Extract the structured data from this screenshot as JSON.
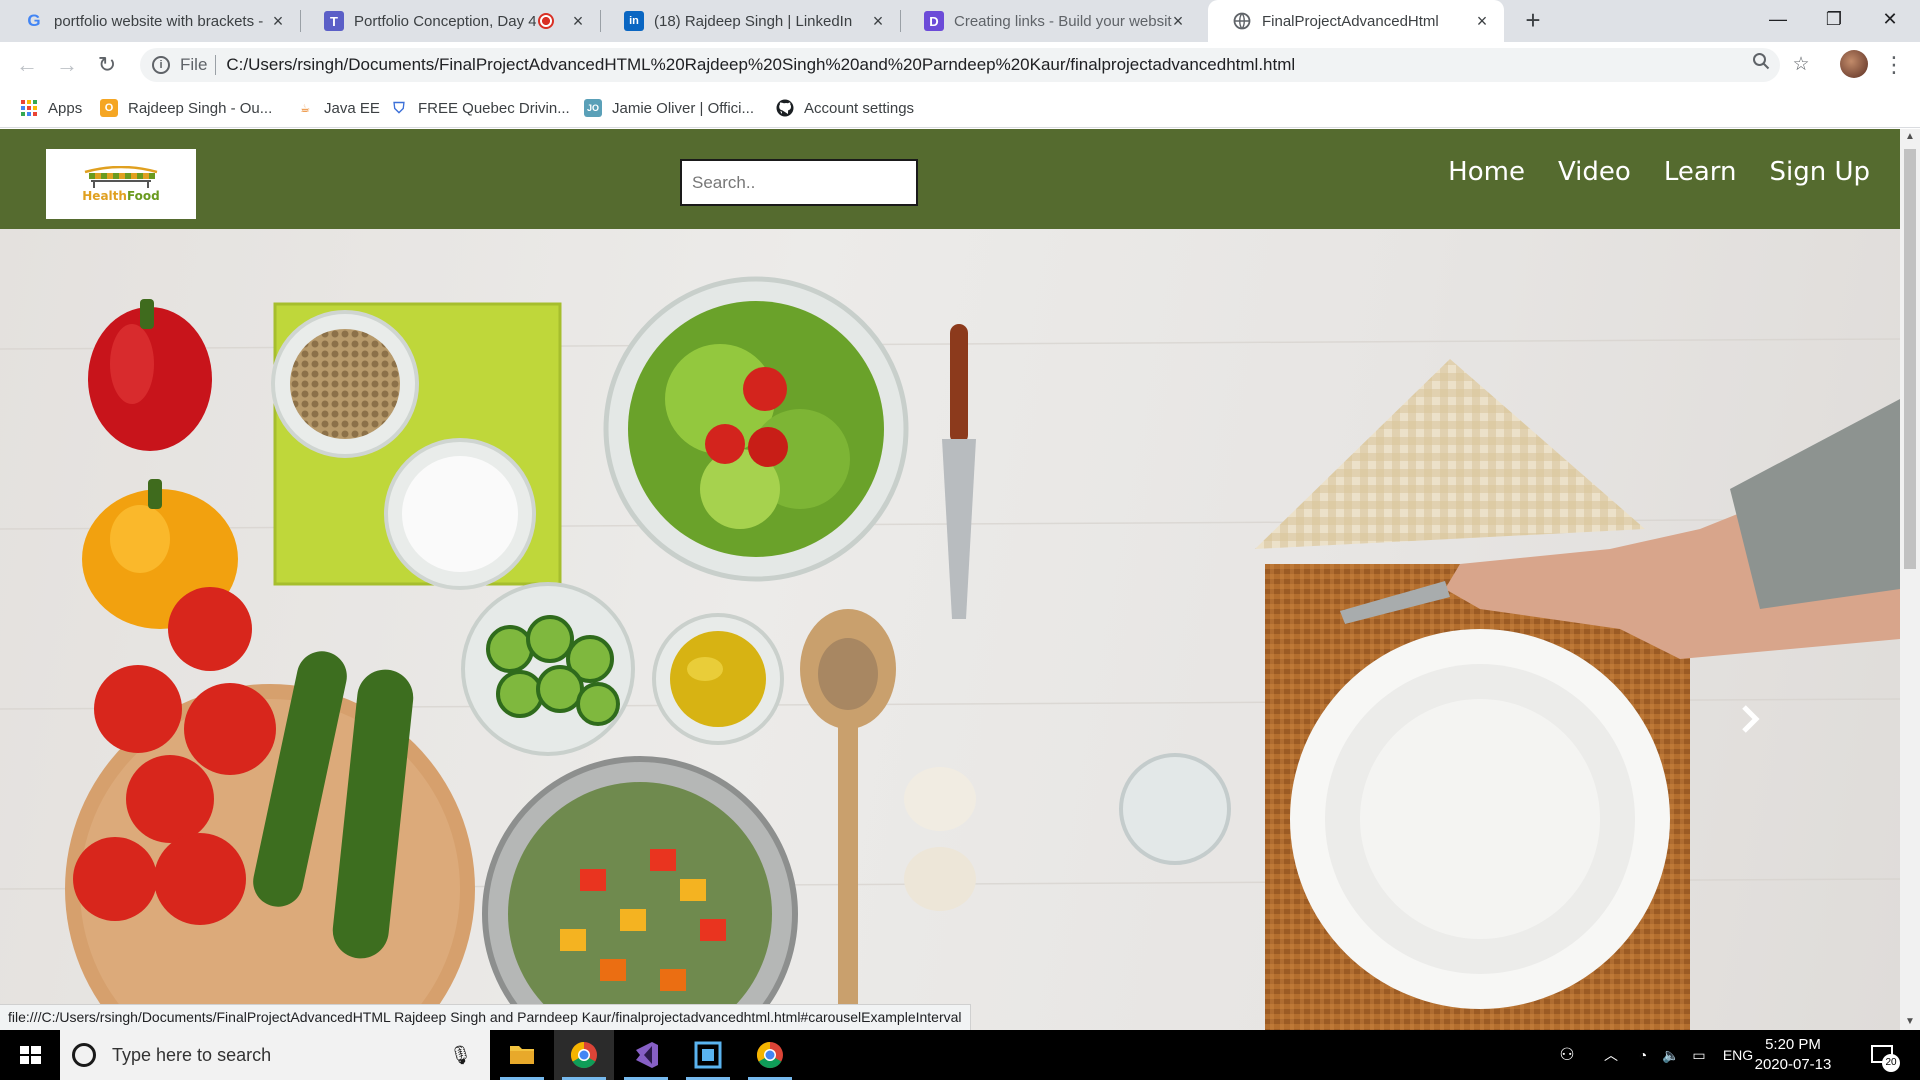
{
  "browser": {
    "tabs": [
      {
        "title": "portfolio website with brackets -",
        "favicon": "google-g-icon"
      },
      {
        "title": "Portfolio Conception, Day 4",
        "favicon": "teams-icon",
        "recording": true
      },
      {
        "title": "(18) Rajdeep Singh | LinkedIn",
        "favicon": "linkedin-icon"
      },
      {
        "title": "Creating links - Build your websit",
        "favicon": "docs-d-icon"
      },
      {
        "title": "FinalProjectAdvancedHtml",
        "favicon": "globe-icon",
        "active": true
      }
    ],
    "address": {
      "scheme": "File",
      "url": "C:/Users/rsingh/Documents/FinalProjectAdvancedHTML%20Rajdeep%20Singh%20and%20Parndeep%20Kaur/finalprojectadvancedhtml.html"
    },
    "bookmarks": [
      {
        "label": "Apps",
        "icon": "apps-grid-icon"
      },
      {
        "label": "Rajdeep Singh - Ou...",
        "icon": "outlook-icon"
      },
      {
        "label": "Java EE",
        "icon": "java-icon"
      },
      {
        "label": "FREE Quebec Drivin...",
        "icon": "shield-icon"
      },
      {
        "label": "Jamie Oliver | Offici...",
        "icon": "jo-icon"
      },
      {
        "label": "Account settings",
        "icon": "github-icon"
      }
    ],
    "status_url": "file:///C:/Users/rsingh/Documents/FinalProjectAdvancedHTML Rajdeep Singh and Parndeep Kaur/finalprojectadvancedhtml.html#carouselExampleInterval"
  },
  "site": {
    "logo_text_part1": "Health",
    "logo_text_part2": "Food",
    "search_placeholder": "Search..",
    "nav": [
      "Home",
      "Video",
      "Learn",
      "Sign Up"
    ],
    "brand_color": "#556b2f"
  },
  "taskbar": {
    "search_placeholder": "Type here to search",
    "language": "ENG",
    "time": "5:20 PM",
    "date": "2020-07-13",
    "notifications": "20"
  }
}
